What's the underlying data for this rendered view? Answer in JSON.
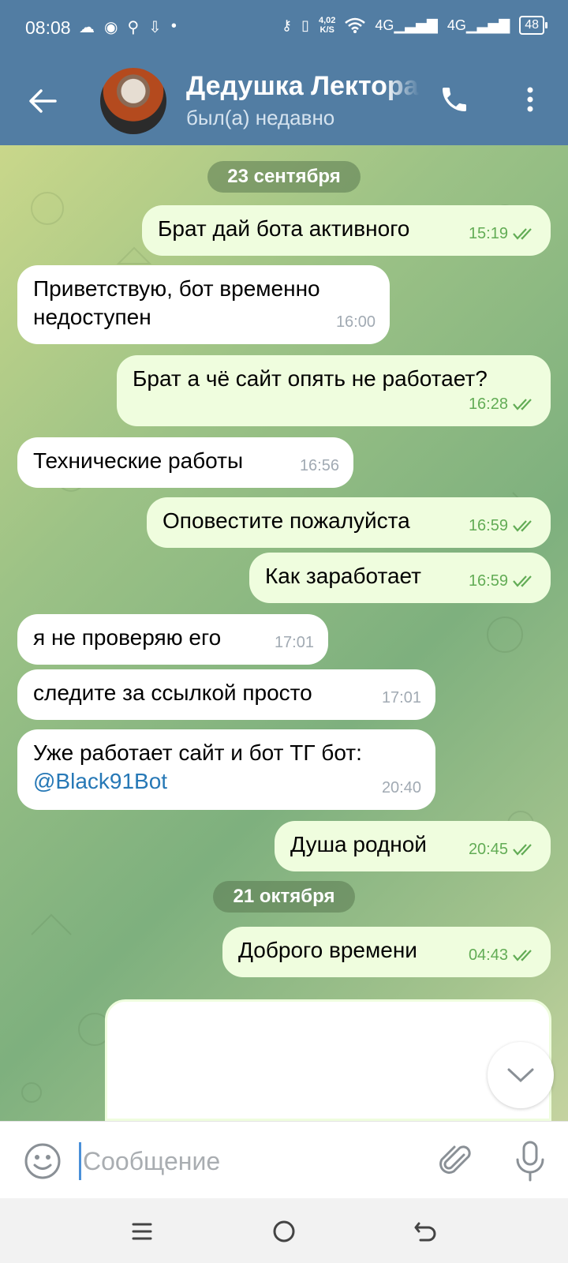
{
  "status_bar": {
    "time": "08:08",
    "net_speed_value": "4,02",
    "net_speed_unit": "K/S",
    "signal_1": "4G",
    "signal_2": "4G",
    "battery": "48"
  },
  "header": {
    "title": "Дедушка Лектора",
    "status": "был(а) недавно"
  },
  "dates": [
    "23 сентября",
    "21 октября"
  ],
  "messages": [
    {
      "dir": "out",
      "text": "Брат дай бота активного",
      "time": "15:19"
    },
    {
      "dir": "in",
      "text": "Приветствую, бот временно недоступен",
      "time": "16:00"
    },
    {
      "dir": "out",
      "text": "Брат а чё сайт опять не работает?",
      "time": "16:28"
    },
    {
      "dir": "in",
      "text": "Технические работы",
      "time": "16:56"
    },
    {
      "dir": "out",
      "text": "Оповестите пожалуйста",
      "time": "16:59"
    },
    {
      "dir": "out",
      "text": "Как заработает",
      "time": "16:59"
    },
    {
      "dir": "in",
      "text": "я не проверяю его",
      "time": "17:01"
    },
    {
      "dir": "in",
      "text": "следите за ссылкой просто",
      "time": "17:01"
    },
    {
      "dir": "in",
      "text": "Уже работает сайт и бот ТГ бот:",
      "link": "@Black91Bot",
      "time": "20:40"
    },
    {
      "dir": "out",
      "text": "Душа родной",
      "time": "20:45"
    },
    {
      "dir": "out",
      "text": "Доброго времени",
      "time": "04:43"
    }
  ],
  "input": {
    "placeholder": "Сообщение"
  },
  "icons": {
    "back": "arrow-left-icon",
    "call": "phone-icon",
    "menu": "more-vertical-icon",
    "emoji": "smiley-icon",
    "attach": "paperclip-icon",
    "mic": "microphone-icon",
    "scroll": "chevron-down-icon",
    "nav_menu": "hamburger-icon",
    "nav_home": "circle-home-icon",
    "nav_back": "return-icon"
  },
  "colors": {
    "header": "#527da3",
    "outgoing_bubble": "#effdde",
    "incoming_bubble": "#ffffff",
    "outgoing_meta": "#62ac55",
    "link": "#2678b6"
  }
}
